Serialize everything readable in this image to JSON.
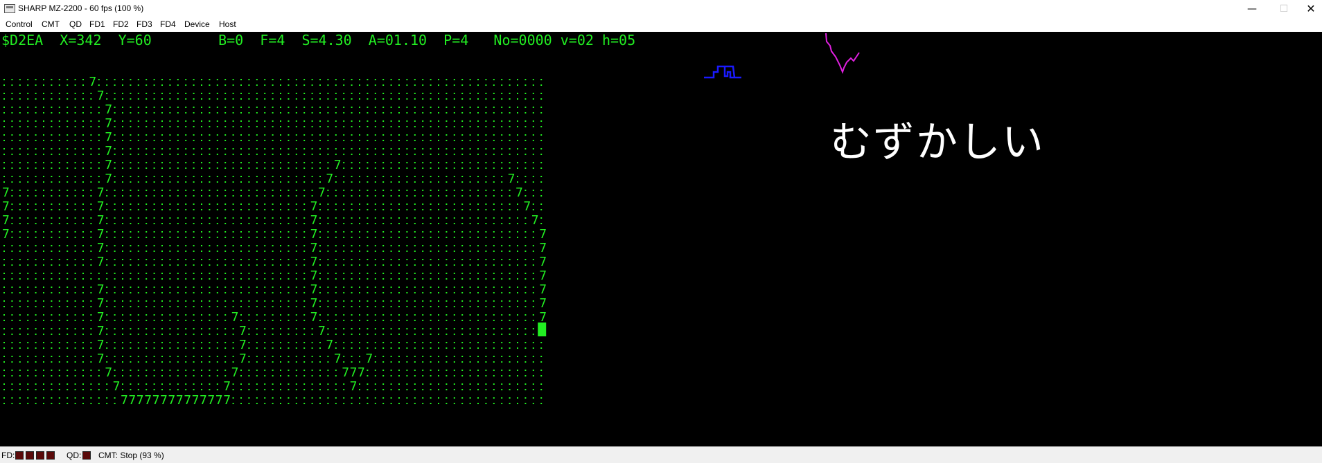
{
  "window": {
    "title": "SHARP MZ-2200 - 60 fps (100 %)",
    "minimize_glyph": "—",
    "maximize_glyph": "☐",
    "close_glyph": "✕"
  },
  "menu": {
    "items": [
      "Control",
      "CMT",
      "QD",
      "FD1",
      "FD2",
      "FD3",
      "FD4",
      "Device",
      "Host"
    ]
  },
  "screen": {
    "status_line": "$D2EA  X=342  Y=60        B=0  F=4  S=4.30  A=01.10  P=4   No=0000 v=02 h=05",
    "grid_char": "7",
    "japanese_text": "むずかしい",
    "colors": {
      "background": "#000000",
      "text": "#22ee22",
      "dots": "#22ee22",
      "cursor": "#22ee22",
      "blue_sprite": "#1a1aff",
      "magenta_sprite": "#e020e0",
      "white_text": "#ffffff"
    }
  },
  "statusbar": {
    "fd_label": "FD:",
    "qd_label": "QD:",
    "cmt_status": "CMT: Stop (93 %)",
    "fd_leds": 4,
    "qd_leds": 1
  }
}
